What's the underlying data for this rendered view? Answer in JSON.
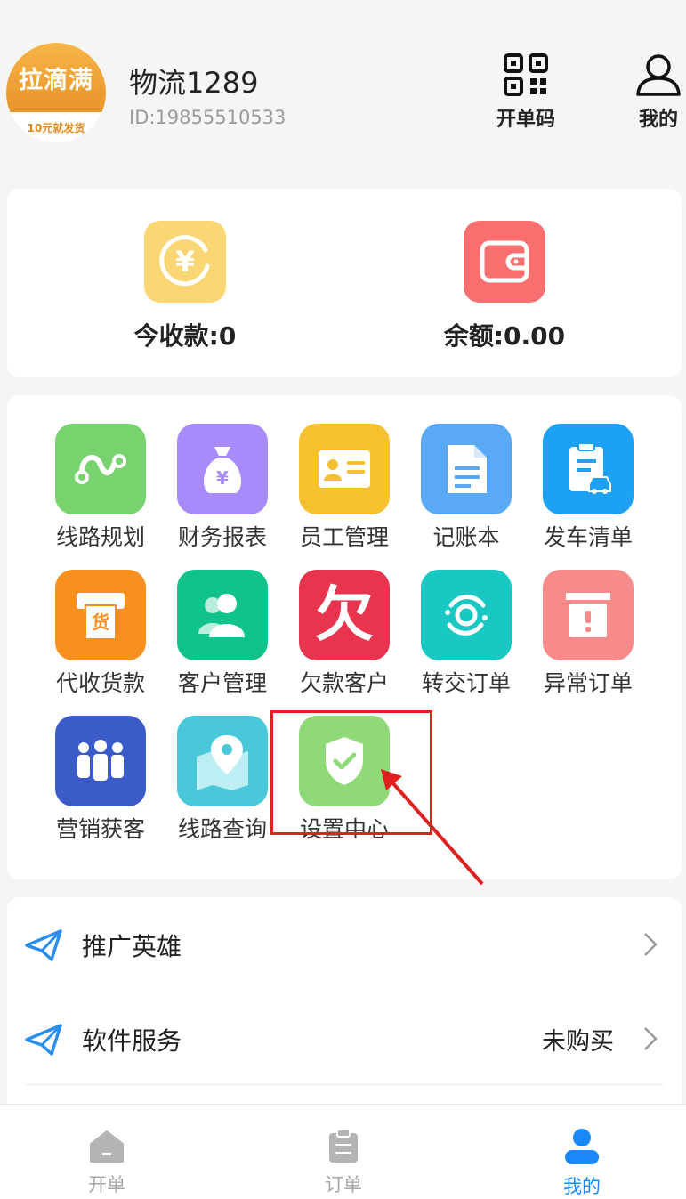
{
  "header": {
    "logo_main": "拉滴满",
    "logo_sub": "10元就发货",
    "user_name": "物流1289",
    "user_id": "ID:19855510533",
    "qr_label": "开单码",
    "me_label": "我的"
  },
  "balance": {
    "today_income": "今收款:0",
    "balance": "余额:0.00",
    "income_color": "#fad774",
    "balance_color": "#f96f6f"
  },
  "grid": {
    "items": [
      {
        "label": "线路规划",
        "color": "#78d36e",
        "icon": "route-icon"
      },
      {
        "label": "财务报表",
        "color": "#a78bfa",
        "icon": "money-bag-icon"
      },
      {
        "label": "员工管理",
        "color": "#f5c12e",
        "icon": "id-card-icon"
      },
      {
        "label": "记账本",
        "color": "#5aa9f6",
        "icon": "document-icon"
      },
      {
        "label": "发车清单",
        "color": "#1da1f2",
        "icon": "clipboard-car-icon"
      },
      {
        "label": "代收货款",
        "color": "#f7901e",
        "icon": "atm-goods-icon"
      },
      {
        "label": "客户管理",
        "color": "#10c28c",
        "icon": "customers-icon"
      },
      {
        "label": "欠款客户",
        "color": "#e9344f",
        "icon": "debt-icon"
      },
      {
        "label": "转交订单",
        "color": "#19c7c3",
        "icon": "transfer-icon"
      },
      {
        "label": "异常订单",
        "color": "#f78b8b",
        "icon": "alert-box-icon"
      },
      {
        "label": "营销获客",
        "color": "#3b5bc9",
        "icon": "people-icon"
      },
      {
        "label": "线路查询",
        "color": "#49c8da",
        "icon": "map-pin-icon"
      },
      {
        "label": "设置中心",
        "color": "#8fd978",
        "icon": "shield-check-icon"
      }
    ],
    "debt_glyph": "欠",
    "goods_glyph": "货",
    "yuan_glyph": "¥"
  },
  "list": {
    "promo": "推广英雄",
    "software": "软件服务",
    "software_status": "未购买"
  },
  "nav": {
    "items": [
      {
        "label": "开单"
      },
      {
        "label": "订单"
      },
      {
        "label": "我的"
      }
    ],
    "active_color": "#1989fa"
  }
}
